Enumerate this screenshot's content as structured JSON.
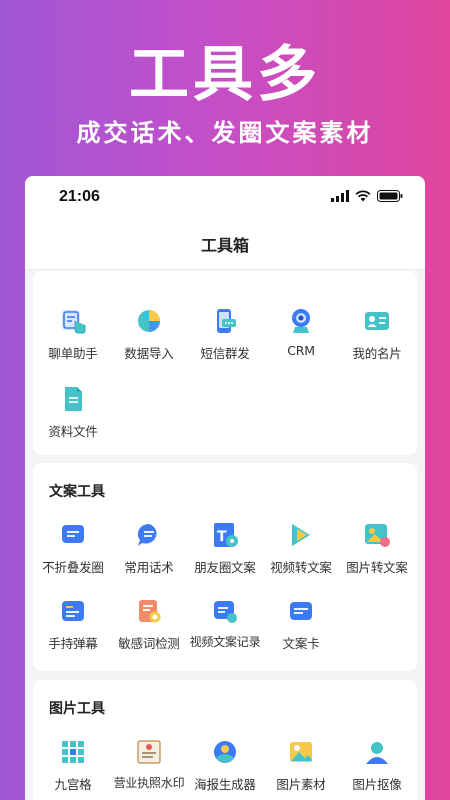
{
  "banner": {
    "title": "工具多",
    "subtitle": "成交话术、发圈文案素材"
  },
  "status_bar": {
    "time": "21:06"
  },
  "nav": {
    "title": "工具箱"
  },
  "sections": [
    {
      "title": "",
      "tools": [
        {
          "label": "聊单助手",
          "icon": "chat-hand-icon"
        },
        {
          "label": "数据导入",
          "icon": "pie-chart-icon"
        },
        {
          "label": "短信群发",
          "icon": "phone-sms-icon"
        },
        {
          "label": "CRM",
          "icon": "webcam-icon"
        },
        {
          "label": "我的名片",
          "icon": "id-card-icon"
        },
        {
          "label": "资料文件",
          "icon": "file-icon"
        }
      ]
    },
    {
      "title": "文案工具",
      "tools": [
        {
          "label": "不折叠发圈",
          "icon": "message-icon"
        },
        {
          "label": "常用话术",
          "icon": "chat-bubble-icon"
        },
        {
          "label": "朋友圈文案",
          "icon": "text-gear-icon"
        },
        {
          "label": "视频转文案",
          "icon": "video-play-icon"
        },
        {
          "label": "图片转文案",
          "icon": "image-text-icon"
        },
        {
          "label": "手持弹幕",
          "icon": "barrage-icon"
        },
        {
          "label": "敏感词检测",
          "icon": "detect-icon"
        },
        {
          "label": "视频文案记录",
          "icon": "video-record-icon"
        },
        {
          "label": "文案卡",
          "icon": "card-icon"
        }
      ]
    },
    {
      "title": "图片工具",
      "tools": [
        {
          "label": "九宫格",
          "icon": "grid-icon"
        },
        {
          "label": "营业执照水印",
          "icon": "license-icon"
        },
        {
          "label": "海报生成器",
          "icon": "poster-icon"
        },
        {
          "label": "图片素材",
          "icon": "image-icon"
        },
        {
          "label": "图片抠像",
          "icon": "portrait-icon"
        }
      ]
    }
  ],
  "colors": {
    "gradient_start": "#a057d6",
    "gradient_end": "#e0459e",
    "icon_blue": "#3d7af5",
    "icon_teal": "#46c3c8",
    "icon_yellow": "#f7c948"
  }
}
